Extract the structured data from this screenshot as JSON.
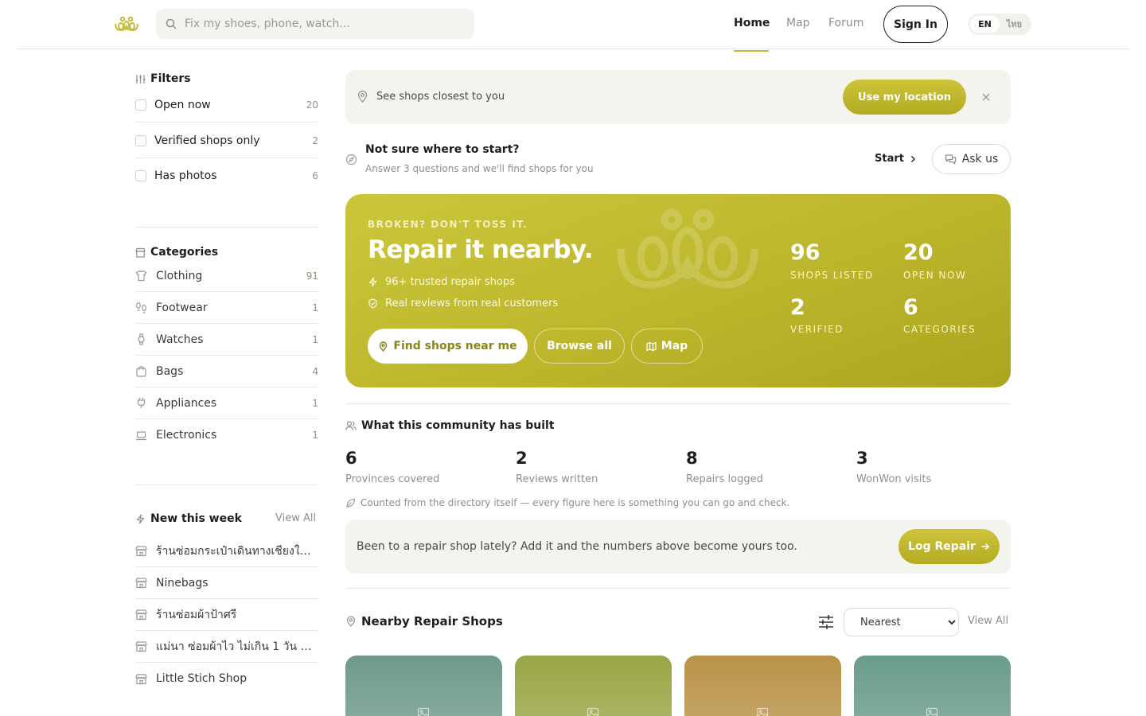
{
  "header": {
    "search_placeholder": "Fix my shoes, phone, watch...",
    "nav": [
      "Home",
      "Map",
      "Forum"
    ],
    "sign_in": "Sign In",
    "lang_en": "EN",
    "lang_th": "ไทย"
  },
  "filters": {
    "title": "Filters",
    "items": [
      {
        "label": "Open now",
        "count": "20"
      },
      {
        "label": "Verified shops only",
        "count": "2"
      },
      {
        "label": "Has photos",
        "count": "6"
      }
    ]
  },
  "categories": {
    "title": "Categories",
    "items": [
      {
        "label": "Clothing",
        "count": "91",
        "icon": "shirt-icon"
      },
      {
        "label": "Footwear",
        "count": "1",
        "icon": "footprints-icon"
      },
      {
        "label": "Watches",
        "count": "1",
        "icon": "watch-icon"
      },
      {
        "label": "Bags",
        "count": "4",
        "icon": "bag-icon"
      },
      {
        "label": "Appliances",
        "count": "1",
        "icon": "plug-icon"
      },
      {
        "label": "Electronics",
        "count": "1",
        "icon": "laptop-icon"
      }
    ]
  },
  "new_this_week": {
    "title": "New this week",
    "view_all": "View All",
    "items": [
      "ร้านซ่อมกระเป๋าเดินทางเชียงใหม่ ...",
      "Ninebags",
      "ร้านซ่อมผ้าป้าศรี",
      "แม่นา ซ่อมผ้าไว ไม่เกิน 1 วัน มารับ...",
      "Little Stich Shop"
    ]
  },
  "location_bar": {
    "text": "See shops closest to you",
    "button": "Use my location"
  },
  "guide": {
    "title": "Not sure where to start?",
    "subtitle": "Answer 3 questions and we'll find shops for you",
    "start": "Start",
    "ask": "Ask us"
  },
  "hero": {
    "eyebrow": "BROKEN? DON'T TOSS IT.",
    "headline": "Repair it nearby.",
    "bullet1": "96+ trusted repair shops",
    "bullet2": "Real reviews from real customers",
    "btn_find": "Find shops near me",
    "btn_browse": "Browse all",
    "btn_map": "Map",
    "stats": [
      {
        "value": "96",
        "label": "SHOPS LISTED"
      },
      {
        "value": "20",
        "label": "OPEN NOW"
      },
      {
        "value": "2",
        "label": "VERIFIED"
      },
      {
        "value": "6",
        "label": "CATEGORIES"
      }
    ]
  },
  "community": {
    "title": "What this community has built",
    "stats": [
      {
        "value": "6",
        "label": "Provinces covered"
      },
      {
        "value": "2",
        "label": "Reviews written"
      },
      {
        "value": "8",
        "label": "Repairs logged"
      },
      {
        "value": "3",
        "label": "WonWon visits"
      }
    ],
    "note": "Counted from the directory itself — every figure here is something you can go and check.",
    "log_text": "Been to a repair shop lately? Add it and the numbers above become yours too.",
    "log_button": "Log Repair"
  },
  "nearby": {
    "title": "Nearby Repair Shops",
    "sort_selected": "Nearest",
    "view_all": "View All"
  },
  "colors": {
    "accent": "#c4bd38",
    "hero_start": "#cbc63c",
    "hero_end": "#aba520",
    "card_colors": [
      "#6f9a8b",
      "#9aa545",
      "#b99248",
      "#6a9c8a"
    ]
  }
}
